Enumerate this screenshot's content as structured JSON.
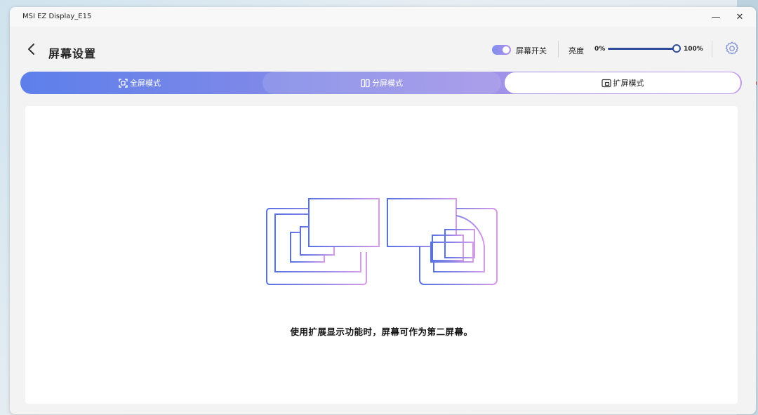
{
  "window": {
    "title": "MSI EZ Display_E15",
    "minimize_glyph": "—",
    "close_glyph": "✕"
  },
  "header": {
    "title": "屏幕设置",
    "screen_toggle_label": "屏幕开关",
    "screen_toggle_on": true,
    "brightness_label": "亮度",
    "brightness_min": "0%",
    "brightness_max": "100%",
    "brightness_value": 100
  },
  "tabs": [
    {
      "label": "全屏模式",
      "icon": "fullscreen-icon",
      "active": false
    },
    {
      "label": "分屏模式",
      "icon": "split-screen-icon",
      "active": false
    },
    {
      "label": "扩屏模式",
      "icon": "extend-screen-icon",
      "active": true
    }
  ],
  "content": {
    "description": "使用扩展显示功能时，屏幕可作为第二屏幕。"
  },
  "colors": {
    "accent_start": "#5d7fea",
    "accent_end": "#c29ae9",
    "slider": "#2f4c9a"
  }
}
